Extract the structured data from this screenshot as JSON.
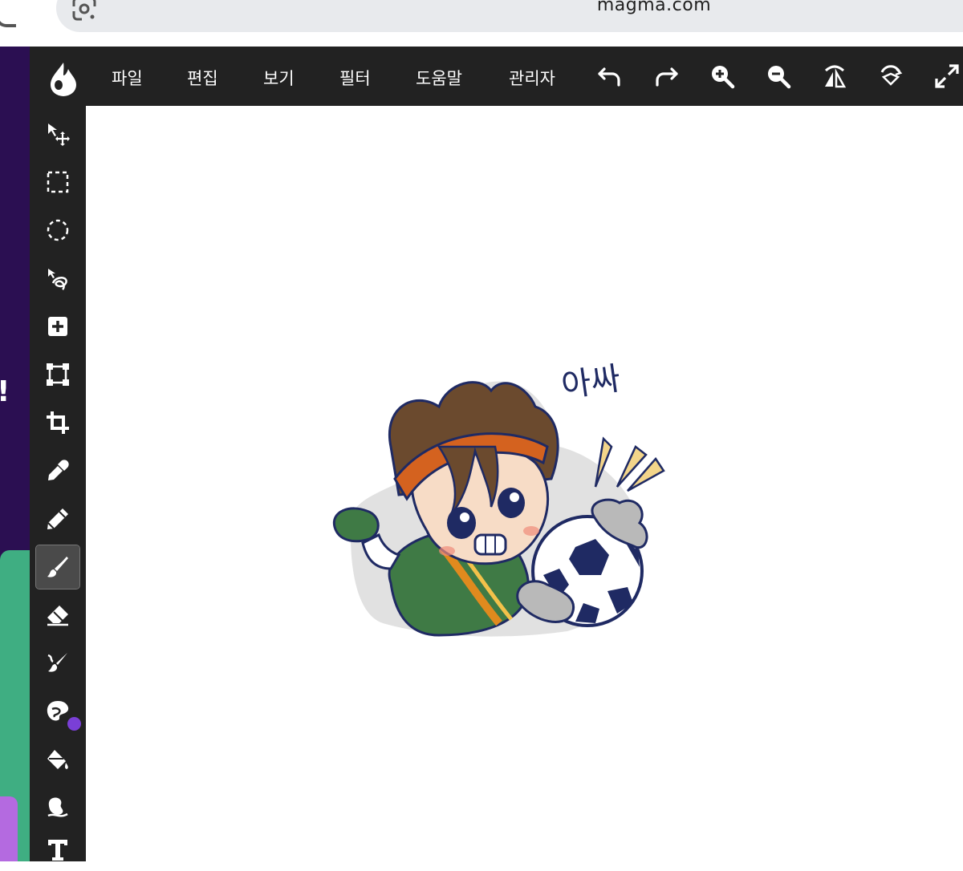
{
  "browser": {
    "url": "magma.com"
  },
  "menu": {
    "items": [
      "파일",
      "편집",
      "보기",
      "필터",
      "도움말",
      "관리자"
    ]
  },
  "toolbar_icons": [
    "undo-icon",
    "redo-icon",
    "zoom-in-icon",
    "zoom-out-icon",
    "flip-icon",
    "rotate-icon",
    "fullscreen-icon"
  ],
  "tools": [
    {
      "name": "move-tool",
      "icon": "move-arrow-icon"
    },
    {
      "name": "rect-select-tool",
      "icon": "dashed-square-icon"
    },
    {
      "name": "ellipse-select-tool",
      "icon": "dashed-circle-icon"
    },
    {
      "name": "lasso-tool",
      "icon": "lasso-icon"
    },
    {
      "name": "add-layer-tool",
      "icon": "plus-square-icon"
    },
    {
      "name": "transform-tool",
      "icon": "transform-square-icon"
    },
    {
      "name": "crop-tool",
      "icon": "crop-icon"
    },
    {
      "name": "eyedropper-tool",
      "icon": "eyedropper-icon"
    },
    {
      "name": "pencil-tool",
      "icon": "pencil-icon"
    },
    {
      "name": "brush-tool",
      "icon": "brush-icon",
      "active": true
    },
    {
      "name": "eraser-tool",
      "icon": "eraser-icon"
    },
    {
      "name": "smudge-tool",
      "icon": "smudge-icon"
    },
    {
      "name": "color-tool",
      "icon": "palette-icon"
    },
    {
      "name": "fill-tool",
      "icon": "paint-bucket-icon"
    },
    {
      "name": "effect-tool",
      "icon": "blob-icon"
    },
    {
      "name": "text-tool",
      "icon": "text-t-icon"
    }
  ],
  "colors": {
    "menubar": "#222222",
    "active_color": "#7a3fd6",
    "site_purple": "#2b0f52",
    "site_green": "#3fae82"
  },
  "canvas": {
    "art_text": "아싸"
  }
}
